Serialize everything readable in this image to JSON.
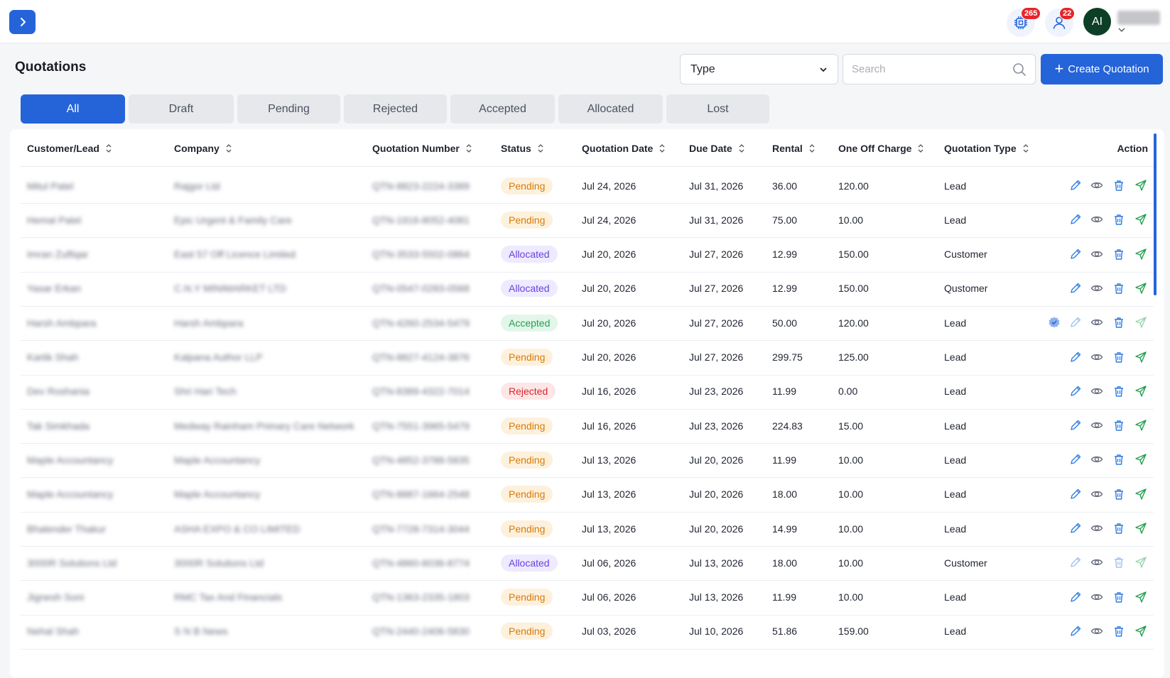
{
  "header": {
    "chip_badge": "265",
    "user_badge": "22",
    "avatar_initials": "AI"
  },
  "page": {
    "title": "Quotations",
    "type_select_value": "Type",
    "search_placeholder": "Search",
    "create_label": "Create Quotation"
  },
  "tabs": [
    {
      "label": "All",
      "active": true
    },
    {
      "label": "Draft"
    },
    {
      "label": "Pending"
    },
    {
      "label": "Rejected"
    },
    {
      "label": "Accepted"
    },
    {
      "label": "Allocated"
    },
    {
      "label": "Lost"
    }
  ],
  "columns": {
    "customer": "Customer/Lead",
    "company": "Company",
    "number": "Quotation Number",
    "status": "Status",
    "qdate": "Quotation Date",
    "due": "Due Date",
    "rental": "Rental",
    "oneoff": "One Off Charge",
    "qtype": "Quotation Type",
    "action": "Action"
  },
  "rows": [
    {
      "customer": "Mitul Patel",
      "company": "Rajgor Ltd",
      "number": "QTN-8823-2224-3389",
      "status": "Pending",
      "qdate": "Jul 24, 2026",
      "due": "Jul 31, 2026",
      "rental": "36.00",
      "oneoff": "120.00",
      "qtype": "Lead"
    },
    {
      "customer": "Hemal Patel",
      "company": "Epic Urgent & Family Care",
      "number": "QTN-1916-8052-4081",
      "status": "Pending",
      "qdate": "Jul 24, 2026",
      "due": "Jul 31, 2026",
      "rental": "75.00",
      "oneoff": "10.00",
      "qtype": "Lead"
    },
    {
      "customer": "Imran Zulfiqar",
      "company": "East 57 Off Licence Limited",
      "number": "QTN-3533-5502-0864",
      "status": "Allocated",
      "qdate": "Jul 20, 2026",
      "due": "Jul 27, 2026",
      "rental": "12.99",
      "oneoff": "150.00",
      "qtype": "Customer"
    },
    {
      "customer": "Yasar Erkan",
      "company": "C.N.Y MINIMARKET LTD",
      "number": "QTN-0547-0283-0568",
      "status": "Allocated",
      "qdate": "Jul 20, 2026",
      "due": "Jul 27, 2026",
      "rental": "12.99",
      "oneoff": "150.00",
      "qtype": "Qustomer"
    },
    {
      "customer": "Harsh Ambpara",
      "company": "Harsh Ambpara",
      "number": "QTN-4260-2534-5479",
      "status": "Accepted",
      "qdate": "Jul 20, 2026",
      "due": "Jul 27, 2026",
      "rental": "50.00",
      "oneoff": "120.00",
      "qtype": "Lead"
    },
    {
      "customer": "Kartik Shah",
      "company": "Kalpana Author LLP",
      "number": "QTN-8827-4124-3876",
      "status": "Pending",
      "qdate": "Jul 20, 2026",
      "due": "Jul 27, 2026",
      "rental": "299.75",
      "oneoff": "125.00",
      "qtype": "Lead"
    },
    {
      "customer": "Dev Roshania",
      "company": "Shri Hari Tech",
      "number": "QTN-8389-4322-7014",
      "status": "Rejected",
      "qdate": "Jul 16, 2026",
      "due": "Jul 23, 2026",
      "rental": "11.99",
      "oneoff": "0.00",
      "qtype": "Lead"
    },
    {
      "customer": "Tak Simkhada",
      "company": "Medway Rainham Primary Care Network",
      "number": "QTN-7551-3965-5479",
      "status": "Pending",
      "qdate": "Jul 16, 2026",
      "due": "Jul 23, 2026",
      "rental": "224.83",
      "oneoff": "15.00",
      "qtype": "Lead"
    },
    {
      "customer": "Maple Accountancy",
      "company": "Maple Accountancy",
      "number": "QTN-4852-3788-5835",
      "status": "Pending",
      "qdate": "Jul 13, 2026",
      "due": "Jul 20, 2026",
      "rental": "11.99",
      "oneoff": "10.00",
      "qtype": "Lead"
    },
    {
      "customer": "Maple Accountancy",
      "company": "Maple Accountancy",
      "number": "QTN-8887-1664-2548",
      "status": "Pending",
      "qdate": "Jul 13, 2026",
      "due": "Jul 20, 2026",
      "rental": "18.00",
      "oneoff": "10.00",
      "qtype": "Lead"
    },
    {
      "customer": "Bhalender Thakur",
      "company": "ASHA EXPO & CO LIMITED",
      "number": "QTN-7728-7314-3044",
      "status": "Pending",
      "qdate": "Jul 13, 2026",
      "due": "Jul 20, 2026",
      "rental": "14.99",
      "oneoff": "10.00",
      "qtype": "Lead"
    },
    {
      "customer": "3000R Solutions Ltd",
      "company": "3000R Solutions Ltd",
      "number": "QTN-4860-6036-8774",
      "status": "Allocated",
      "qdate": "Jul 06, 2026",
      "due": "Jul 13, 2026",
      "rental": "18.00",
      "oneoff": "10.00",
      "qtype": "Customer"
    },
    {
      "customer": "Jignesh Soni",
      "company": "RMC Tax And Financials",
      "number": "QTN-1363-2335-1803",
      "status": "Pending",
      "qdate": "Jul 06, 2026",
      "due": "Jul 13, 2026",
      "rental": "11.99",
      "oneoff": "10.00",
      "qtype": "Lead"
    },
    {
      "customer": "Nehal Shah",
      "company": "S N B News",
      "number": "QTN-2440-2406-5830",
      "status": "Pending",
      "qdate": "Jul 03, 2026",
      "due": "Jul 10, 2026",
      "rental": "51.86",
      "oneoff": "159.00",
      "qtype": "Lead"
    }
  ]
}
